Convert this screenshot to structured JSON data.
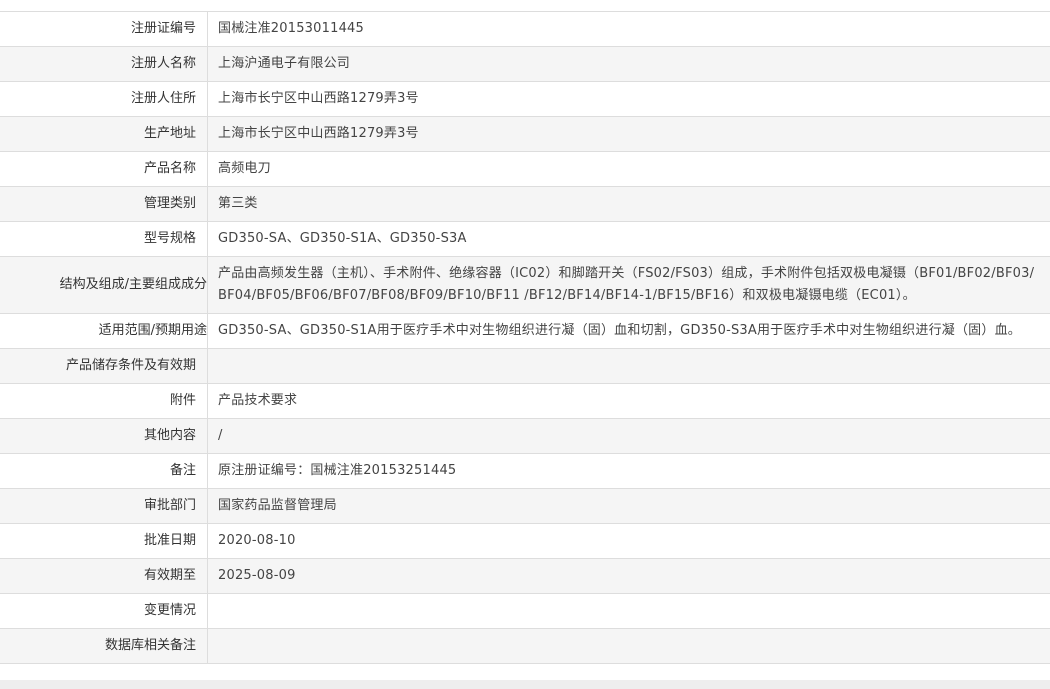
{
  "rows": [
    {
      "label": "注册证编号",
      "value": "国械注准20153011445"
    },
    {
      "label": "注册人名称",
      "value": "上海沪通电子有限公司"
    },
    {
      "label": "注册人住所",
      "value": "上海市长宁区中山西路1279弄3号"
    },
    {
      "label": "生产地址",
      "value": "上海市长宁区中山西路1279弄3号"
    },
    {
      "label": "产品名称",
      "value": "高频电刀"
    },
    {
      "label": "管理类别",
      "value": "第三类"
    },
    {
      "label": "型号规格",
      "value": "GD350-SA、GD350-S1A、GD350-S3A"
    },
    {
      "label": "结构及组成/主要组成成分",
      "value": "产品由高频发生器（主机）、手术附件、绝缘容器（IC02）和脚踏开关（FS02/FS03）组成，手术附件包括双极电凝镊（BF01/BF02/BF03/BF04/BF05/BF06/BF07/BF08/BF09/BF10/BF11 /BF12/BF14/BF14-1/BF15/BF16）和双极电凝镊电缆（EC01）。"
    },
    {
      "label": "适用范围/预期用途",
      "value": "GD350-SA、GD350-S1A用于医疗手术中对生物组织进行凝（固）血和切割，GD350-S3A用于医疗手术中对生物组织进行凝（固）血。"
    },
    {
      "label": "产品储存条件及有效期",
      "value": ""
    },
    {
      "label": "附件",
      "value": "产品技术要求"
    },
    {
      "label": "其他内容",
      "value": "/"
    },
    {
      "label": "备注",
      "value": "原注册证编号：国械注准20153251445"
    },
    {
      "label": "审批部门",
      "value": "国家药品监督管理局"
    },
    {
      "label": "批准日期",
      "value": "2020-08-10"
    },
    {
      "label": "有效期至",
      "value": "2025-08-09"
    },
    {
      "label": "变更情况",
      "value": ""
    },
    {
      "label": "数据库相关备注",
      "value": ""
    }
  ]
}
